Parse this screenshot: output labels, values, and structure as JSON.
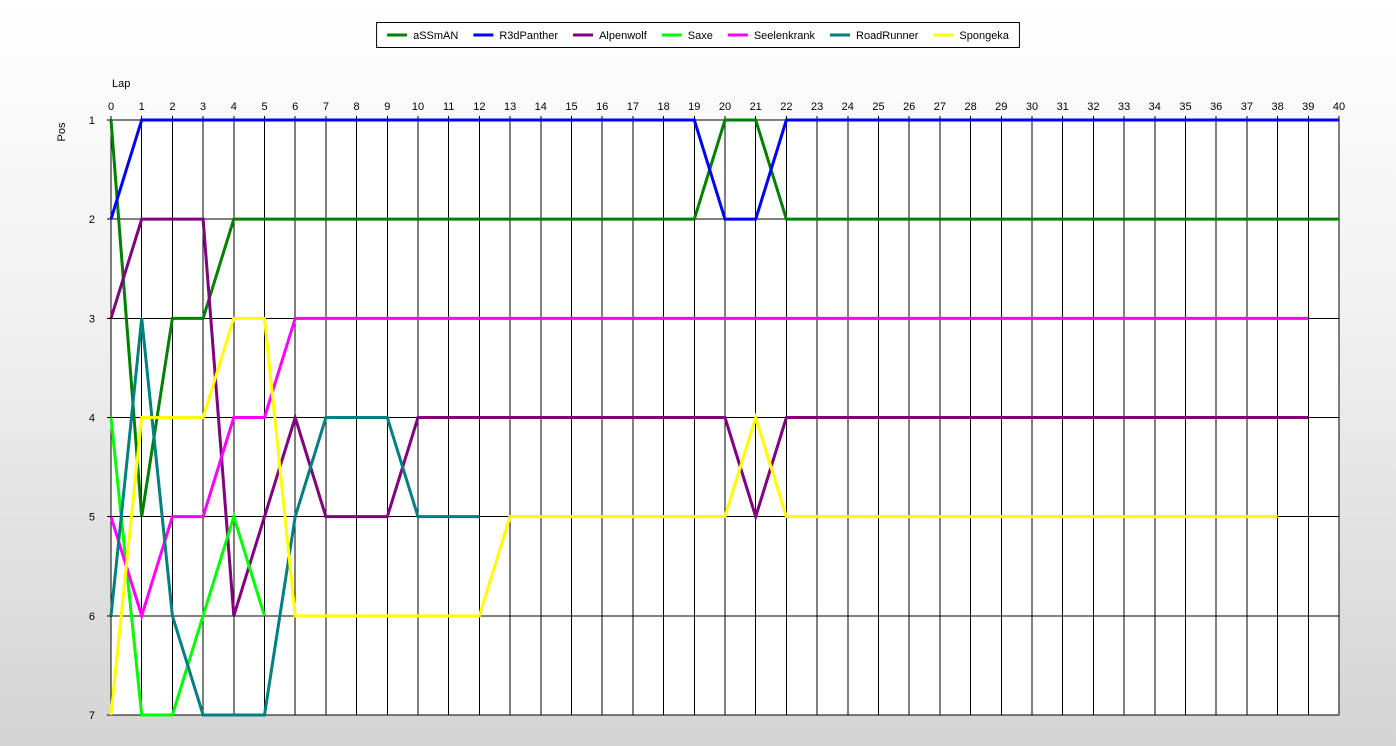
{
  "chart_data": {
    "type": "line",
    "xlabel": "Lap",
    "ylabel": "Pos",
    "xlim": [
      0,
      40
    ],
    "ylim": [
      1,
      7
    ],
    "y_inverted": true,
    "grid": true,
    "legend_position": "top-center",
    "x_ticks": [
      0,
      1,
      2,
      3,
      4,
      5,
      6,
      7,
      8,
      9,
      10,
      11,
      12,
      13,
      14,
      15,
      16,
      17,
      18,
      19,
      20,
      21,
      22,
      23,
      24,
      25,
      26,
      27,
      28,
      29,
      30,
      31,
      32,
      33,
      34,
      35,
      36,
      37,
      38,
      39,
      40
    ],
    "y_ticks": [
      1,
      2,
      3,
      4,
      5,
      6,
      7
    ],
    "series": [
      {
        "name": "aSSmAN",
        "color": "#008000",
        "points": [
          [
            0,
            1
          ],
          [
            1,
            5
          ],
          [
            2,
            3
          ],
          [
            3,
            3
          ],
          [
            4,
            2
          ],
          [
            5,
            2
          ],
          [
            19,
            2
          ],
          [
            20,
            1
          ],
          [
            21,
            1
          ],
          [
            22,
            2
          ],
          [
            40,
            2
          ]
        ]
      },
      {
        "name": "R3dPanther",
        "color": "#0000ff",
        "points": [
          [
            0,
            2
          ],
          [
            1,
            1
          ],
          [
            19,
            1
          ],
          [
            20,
            2
          ],
          [
            21,
            2
          ],
          [
            22,
            1
          ],
          [
            40,
            1
          ]
        ]
      },
      {
        "name": "Alpenwolf",
        "color": "#800080",
        "points": [
          [
            0,
            3
          ],
          [
            1,
            2
          ],
          [
            2,
            2
          ],
          [
            3,
            2
          ],
          [
            4,
            6
          ],
          [
            5,
            5
          ],
          [
            6,
            4
          ],
          [
            7,
            5
          ],
          [
            8,
            5
          ],
          [
            9,
            5
          ],
          [
            10,
            4
          ],
          [
            20,
            4
          ],
          [
            21,
            5
          ],
          [
            22,
            4
          ],
          [
            39,
            4
          ]
        ]
      },
      {
        "name": "Saxe",
        "color": "#00ff00",
        "points": [
          [
            0,
            4
          ],
          [
            1,
            7
          ],
          [
            2,
            7
          ],
          [
            3,
            6
          ],
          [
            4,
            5
          ],
          [
            5,
            6
          ]
        ]
      },
      {
        "name": "Seelenkrank",
        "color": "#ff00ff",
        "points": [
          [
            0,
            5
          ],
          [
            1,
            6
          ],
          [
            2,
            5
          ],
          [
            3,
            5
          ],
          [
            4,
            4
          ],
          [
            5,
            4
          ],
          [
            6,
            3
          ],
          [
            39,
            3
          ]
        ]
      },
      {
        "name": "RoadRunner",
        "color": "#008080",
        "points": [
          [
            0,
            6
          ],
          [
            1,
            3
          ],
          [
            2,
            6
          ],
          [
            3,
            7
          ],
          [
            4,
            7
          ],
          [
            5,
            7
          ],
          [
            6,
            5
          ],
          [
            7,
            4
          ],
          [
            8,
            4
          ],
          [
            9,
            4
          ],
          [
            10,
            5
          ],
          [
            11,
            5
          ],
          [
            12,
            5
          ]
        ]
      },
      {
        "name": "Spongeka",
        "color": "#ffff00",
        "points": [
          [
            0,
            7
          ],
          [
            1,
            4
          ],
          [
            2,
            4
          ],
          [
            3,
            4
          ],
          [
            4,
            3
          ],
          [
            5,
            3
          ],
          [
            6,
            6
          ],
          [
            12,
            6
          ],
          [
            13,
            5
          ],
          [
            20,
            5
          ],
          [
            21,
            4
          ],
          [
            22,
            5
          ],
          [
            38,
            5
          ]
        ]
      }
    ]
  }
}
